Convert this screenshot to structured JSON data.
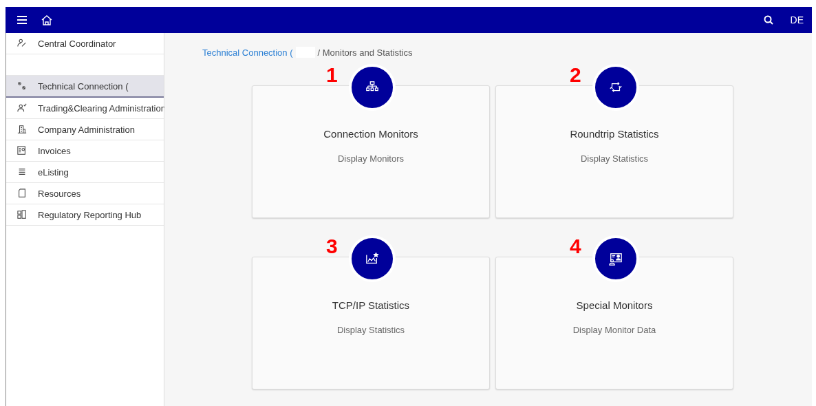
{
  "header": {
    "language": "DE"
  },
  "sidebar": {
    "items": [
      {
        "kind": "link",
        "label": "Central Coordinator",
        "selected": false
      },
      {
        "kind": "blank"
      },
      {
        "kind": "link",
        "label": "Technical Connection (",
        "selected": true
      },
      {
        "kind": "link",
        "label": "Trading&Clearing Administration",
        "selected": false
      },
      {
        "kind": "link",
        "label": "Company Administration",
        "selected": false
      },
      {
        "kind": "link",
        "label": "Invoices",
        "selected": false
      },
      {
        "kind": "link",
        "label": "eListing",
        "selected": false
      },
      {
        "kind": "link",
        "label": "Resources",
        "selected": false
      },
      {
        "kind": "link",
        "label": "Regulatory Reporting Hub",
        "selected": false
      }
    ]
  },
  "breadcrumb": {
    "link": "Technical Connection (",
    "current": "/ Monitors and Statistics"
  },
  "tiles": [
    {
      "marker": "1",
      "title": "Connection Monitors",
      "subtitle": "Display Monitors"
    },
    {
      "marker": "2",
      "title": "Roundtrip Statistics",
      "subtitle": "Display Statistics"
    },
    {
      "marker": "3",
      "title": "TCP/IP Statistics",
      "subtitle": "Display Statistics"
    },
    {
      "marker": "4",
      "title": "Special Monitors",
      "subtitle": "Display Monitor Data"
    }
  ]
}
